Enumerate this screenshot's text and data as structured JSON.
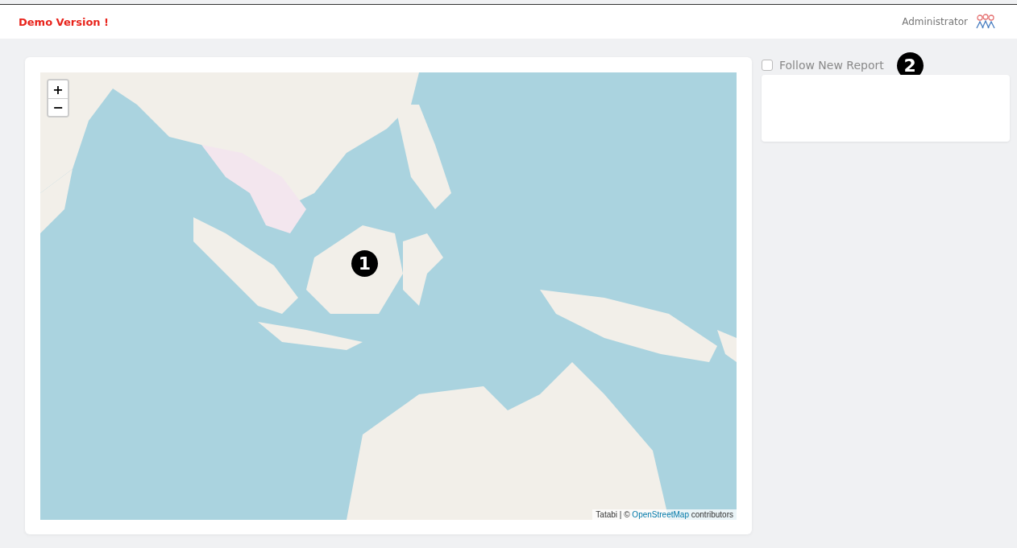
{
  "header": {
    "title": "Demo Version !",
    "user": "Administrator"
  },
  "map": {
    "kind": "picture",
    "zoom_in": "+",
    "zoom_out": "−",
    "attribution_prefix": "Tatabi | ©",
    "attribution_link": "OpenStreetMap",
    "attribution_suffix": "contributors",
    "marker": "1"
  },
  "follow": {
    "label": "Follow New Report",
    "checked": false,
    "marker": "2"
  }
}
